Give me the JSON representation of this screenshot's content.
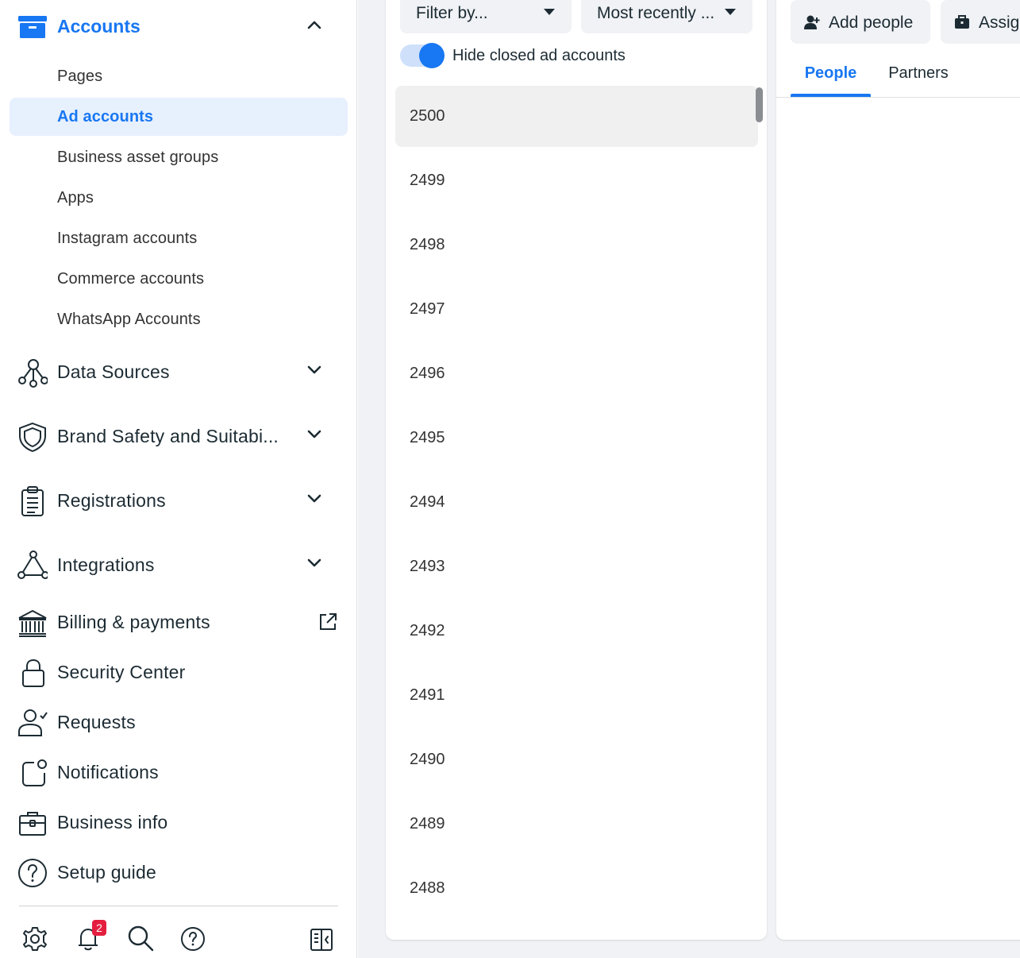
{
  "sidebar": {
    "accounts_header": {
      "label": "Accounts",
      "icon": "archive-box-icon",
      "expanded": true
    },
    "accounts_items": [
      {
        "label": "Pages",
        "active": false
      },
      {
        "label": "Ad accounts",
        "active": true
      },
      {
        "label": "Business asset groups",
        "active": false
      },
      {
        "label": "Apps",
        "active": false
      },
      {
        "label": "Instagram accounts",
        "active": false
      },
      {
        "label": "Commerce accounts",
        "active": false
      },
      {
        "label": "WhatsApp Accounts",
        "active": false
      }
    ],
    "nav": [
      {
        "label": "Data Sources",
        "icon": "data-sources-icon",
        "trailing": "chevron-down-icon"
      },
      {
        "label": "Brand Safety and Suitabi...",
        "icon": "shield-icon",
        "trailing": "chevron-down-icon"
      },
      {
        "label": "Registrations",
        "icon": "clipboard-icon",
        "trailing": "chevron-down-icon"
      },
      {
        "label": "Integrations",
        "icon": "integrations-icon",
        "trailing": "chevron-down-icon"
      },
      {
        "label": "Billing & payments",
        "icon": "bank-icon",
        "trailing": "external-link-icon"
      },
      {
        "label": "Security Center",
        "icon": "lock-icon",
        "trailing": ""
      },
      {
        "label": "Requests",
        "icon": "person-check-icon",
        "trailing": ""
      },
      {
        "label": "Notifications",
        "icon": "notification-icon",
        "trailing": ""
      },
      {
        "label": "Business info",
        "icon": "briefcase-icon",
        "trailing": ""
      },
      {
        "label": "Setup guide",
        "icon": "question-circle-icon",
        "trailing": ""
      }
    ],
    "bottom_icons": [
      "gear-icon",
      "bell-icon",
      "search-icon",
      "help-icon",
      "panel-toggle-icon"
    ],
    "notification_badge": "2"
  },
  "list_panel": {
    "filter_dropdown": {
      "label": "Filter by..."
    },
    "sort_dropdown": {
      "label": "Most recently ..."
    },
    "toggle": {
      "label": "Hide closed ad accounts",
      "on": true
    },
    "accounts": [
      "2500",
      "2499",
      "2498",
      "2497",
      "2496",
      "2495",
      "2494",
      "2493",
      "2492",
      "2491",
      "2490",
      "2489",
      "2488"
    ],
    "selected_index": 0
  },
  "detail_panel": {
    "add_people_button": {
      "label": "Add people",
      "icon": "add-person-icon"
    },
    "assign_button": {
      "label": "Assig",
      "icon": "briefcase-icon"
    },
    "tabs": [
      {
        "label": "People",
        "active": true
      },
      {
        "label": "Partners",
        "active": false
      }
    ]
  },
  "colors": {
    "accent": "#1877f2",
    "active_bg": "#e7f0fd",
    "panel_bg": "#f0f2f5",
    "badge": "#e41e3f"
  }
}
